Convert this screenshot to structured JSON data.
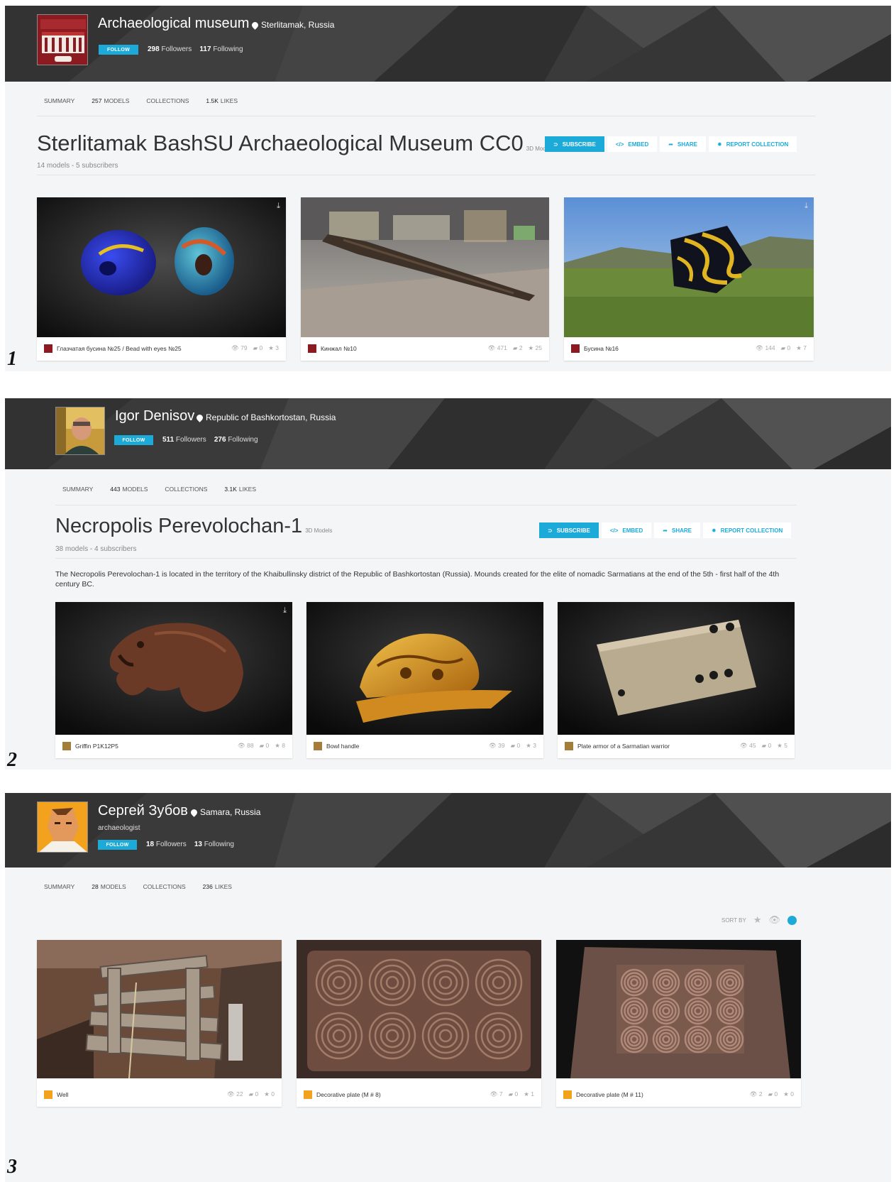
{
  "figures": [
    {
      "label": "1",
      "profile": {
        "name": "Archaeological museum",
        "location": "Sterlitamak, Russia",
        "role": "",
        "follow_label": "FOLLOW",
        "followers_count": "298",
        "followers_label": "Followers",
        "following_count": "117",
        "following_label": "Following"
      },
      "tabs": [
        {
          "count": "",
          "label": "SUMMARY"
        },
        {
          "count": "257",
          "label": "MODELS"
        },
        {
          "count": "",
          "label": "COLLECTIONS"
        },
        {
          "count": "1.5K",
          "label": "LIKES"
        }
      ],
      "collection": {
        "title": "Sterlitamak BashSU Archaeological Museum CC0",
        "kind": "3D Models",
        "subtitle": "14 models - 5 subscribers",
        "description": ""
      },
      "actions": [
        "SUBSCRIBE",
        "EMBED",
        "SHARE",
        "REPORT COLLECTION"
      ],
      "cards": [
        {
          "title": "Глазчатая бусина №25 / Bead with eyes №25",
          "views": "79",
          "comments": "0",
          "likes": "3",
          "thumb": "beads-blue"
        },
        {
          "title": "Кинжал №10",
          "views": "471",
          "comments": "2",
          "likes": "25",
          "thumb": "dagger-street"
        },
        {
          "title": "Бусина №16",
          "views": "144",
          "comments": "0",
          "likes": "7",
          "thumb": "bead-field"
        }
      ]
    },
    {
      "label": "2",
      "profile": {
        "name": "Igor Denisov",
        "location": "Republic of Bashkortostan, Russia",
        "role": "",
        "follow_label": "FOLLOW",
        "followers_count": "511",
        "followers_label": "Followers",
        "following_count": "276",
        "following_label": "Following"
      },
      "tabs": [
        {
          "count": "",
          "label": "SUMMARY"
        },
        {
          "count": "443",
          "label": "MODELS"
        },
        {
          "count": "",
          "label": "COLLECTIONS"
        },
        {
          "count": "3.1K",
          "label": "LIKES"
        }
      ],
      "collection": {
        "title": "Necropolis Perevolochan-1",
        "kind": "3D Models",
        "subtitle": "38 models - 4 subscribers",
        "description": "The Necropolis Perevolochan-1 is located in the territory of the Khaibullinsky district of the Republic of Bashkortostan (Russia). Mounds created for the elite of nomadic Sarmatians at the end of the 5th - first half of the 4th century BC."
      },
      "actions": [
        "SUBSCRIBE",
        "EMBED",
        "SHARE",
        "REPORT COLLECTION"
      ],
      "cards": [
        {
          "title": "Griffin P1K12P5",
          "views": "88",
          "comments": "0",
          "likes": "8",
          "thumb": "griffin"
        },
        {
          "title": "Bowl handle",
          "views": "39",
          "comments": "0",
          "likes": "3",
          "thumb": "gold-handle"
        },
        {
          "title": "Plate armor of a Sarmatian warrior",
          "views": "45",
          "comments": "0",
          "likes": "5",
          "thumb": "bone-plate"
        }
      ]
    },
    {
      "label": "3",
      "profile": {
        "name": "Сергей Зубов",
        "location": "Samara, Russia",
        "role": "archaeologist",
        "follow_label": "FOLLOW",
        "followers_count": "18",
        "followers_label": "Followers",
        "following_count": "13",
        "following_label": "Following"
      },
      "tabs": [
        {
          "count": "",
          "label": "SUMMARY"
        },
        {
          "count": "28",
          "label": "MODELS"
        },
        {
          "count": "",
          "label": "COLLECTIONS"
        },
        {
          "count": "236",
          "label": "LIKES"
        }
      ],
      "sort_label": "SORT BY",
      "cards": [
        {
          "title": "Well",
          "views": "22",
          "comments": "0",
          "likes": "0",
          "thumb": "well"
        },
        {
          "title": "Decorative plate (M # 8)",
          "views": "7",
          "comments": "0",
          "likes": "1",
          "thumb": "spiral-plate-8"
        },
        {
          "title": "Decorative plate (M # 11)",
          "views": "2",
          "comments": "0",
          "likes": "0",
          "thumb": "spiral-plate-11"
        }
      ]
    }
  ],
  "colors": {
    "accent": "#1caad9",
    "banner": "#3b3b3b",
    "panel": "#f4f5f6"
  }
}
